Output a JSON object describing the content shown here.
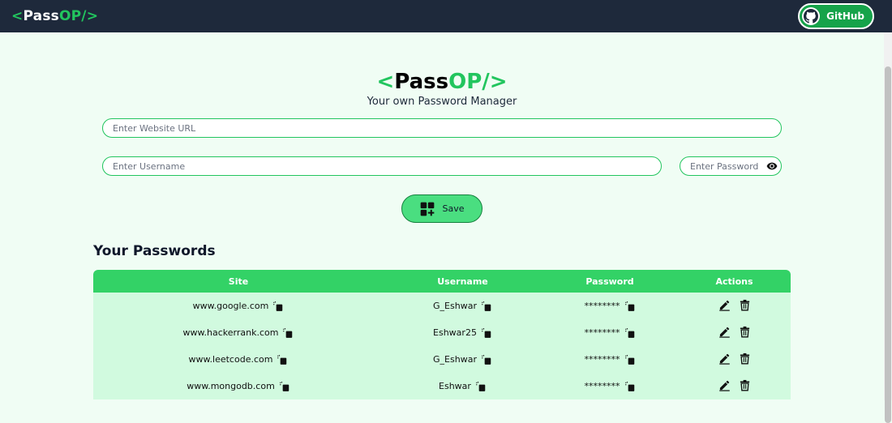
{
  "navbar": {
    "logo": {
      "lt": "<",
      "pass": "Pass",
      "op": "OP",
      "slash": "/",
      "gt": ">"
    },
    "github_label": "GitHub"
  },
  "hero": {
    "logo": {
      "lt": "<",
      "pass": "Pass",
      "op": "OP",
      "slash": "/",
      "gt": ">"
    },
    "subtitle": "Your own Password Manager"
  },
  "form": {
    "url_placeholder": "Enter Website URL",
    "url_value": "",
    "username_placeholder": "Enter Username",
    "username_value": "",
    "password_placeholder": "Enter Password",
    "password_value": "",
    "save_label": "Save"
  },
  "passwords": {
    "title": "Your Passwords",
    "columns": {
      "site": "Site",
      "username": "Username",
      "password": "Password",
      "actions": "Actions"
    },
    "rows": [
      {
        "site": "www.google.com",
        "username": "G_Eshwar",
        "password": "********"
      },
      {
        "site": "www.hackerrank.com",
        "username": "Eshwar25",
        "password": "********"
      },
      {
        "site": "www.leetcode.com",
        "username": "G_Eshwar",
        "password": "********"
      },
      {
        "site": "www.mongodb.com",
        "username": "Eshwar",
        "password": "********"
      }
    ]
  },
  "colors": {
    "accent": "#22c55e",
    "navbar": "#1e293b",
    "background": "#f0fdf4",
    "table_header": "#33d266",
    "table_row": "#d1fadf"
  }
}
